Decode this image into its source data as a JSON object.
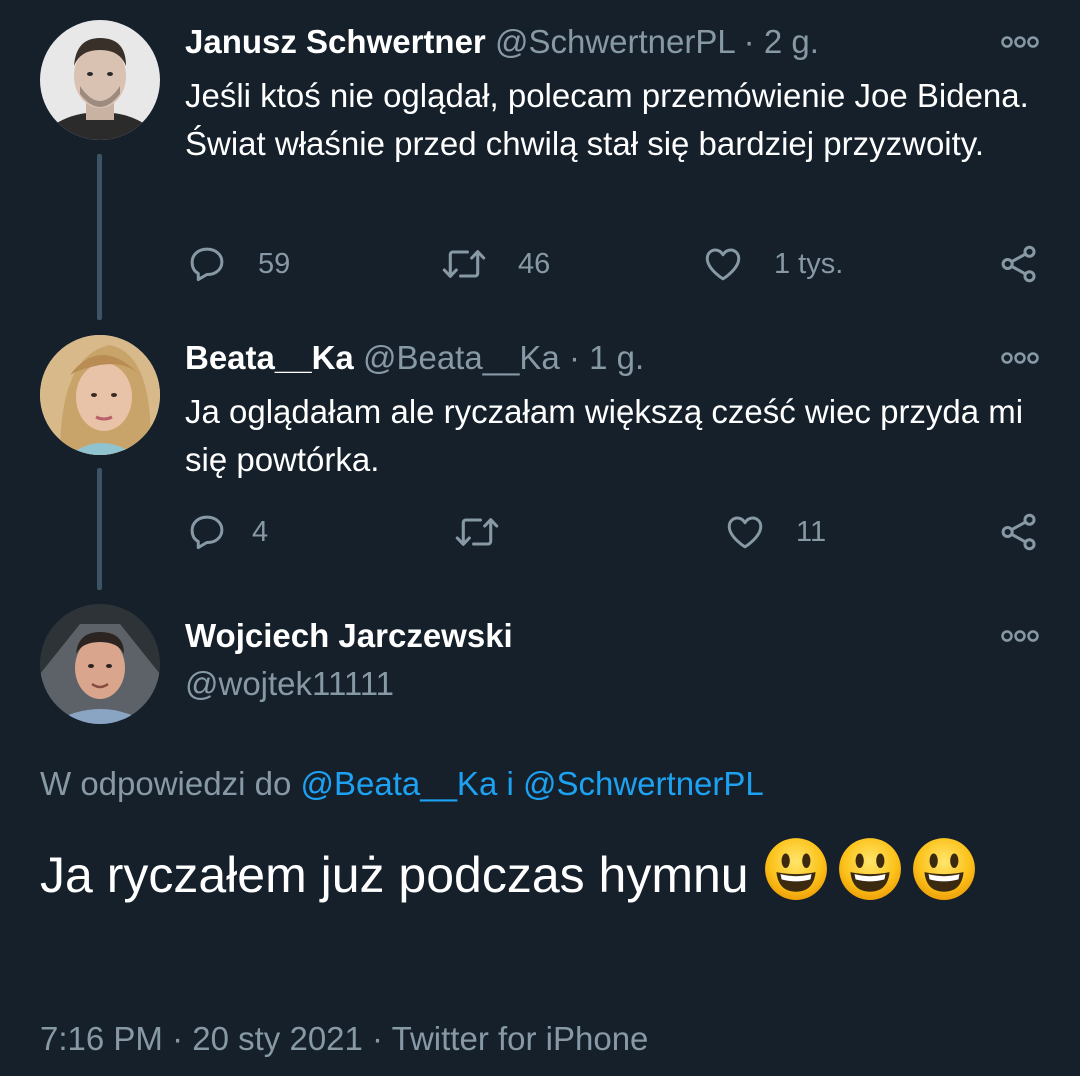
{
  "tweets": [
    {
      "name": "Janusz Schwertner",
      "handle": "@SchwertnerPL",
      "separator": "·",
      "time": "2 g.",
      "text": "Jeśli ktoś nie oglądał, polecam przemówienie Joe Bidena. Świat właśnie przed chwilą stał się bardziej przyzwoity.",
      "reply_count": "59",
      "retweet_count": "46",
      "like_count": "1 tys."
    },
    {
      "name": "Beata__Ka",
      "handle": "@Beata__Ka",
      "separator": "·",
      "time": "1 g.",
      "text": "Ja oglądałam ale ryczałam większą cześć wiec przyda mi się powtórka.",
      "reply_count": "4",
      "retweet_count": "",
      "like_count": "11"
    }
  ],
  "main_tweet": {
    "name": "Wojciech Jarczewski",
    "handle": "@wojtek11111",
    "reply_prefix": "W odpowiedzi do",
    "mention_1": "@Beata__Ka",
    "reply_joiner": "i",
    "mention_2": "@SchwertnerPL",
    "text": "Ja ryczałem już podczas hymnu",
    "emoji_names": [
      "grinning-face-icon",
      "grinning-face-icon",
      "grinning-face-icon"
    ],
    "time": "7:16 PM",
    "date": "20 sty 2021",
    "separator": "·",
    "source": "Twitter for iPhone"
  },
  "colors": {
    "background": "#15202b",
    "text": "#ffffff",
    "secondary": "#8899a6",
    "link": "#1da1f2",
    "thread_line": "#3d5466"
  },
  "icons": {
    "reply": "reply-bubble-icon",
    "retweet": "retweet-icon",
    "like": "heart-icon",
    "share": "share-icon",
    "more": "more-options-icon"
  }
}
